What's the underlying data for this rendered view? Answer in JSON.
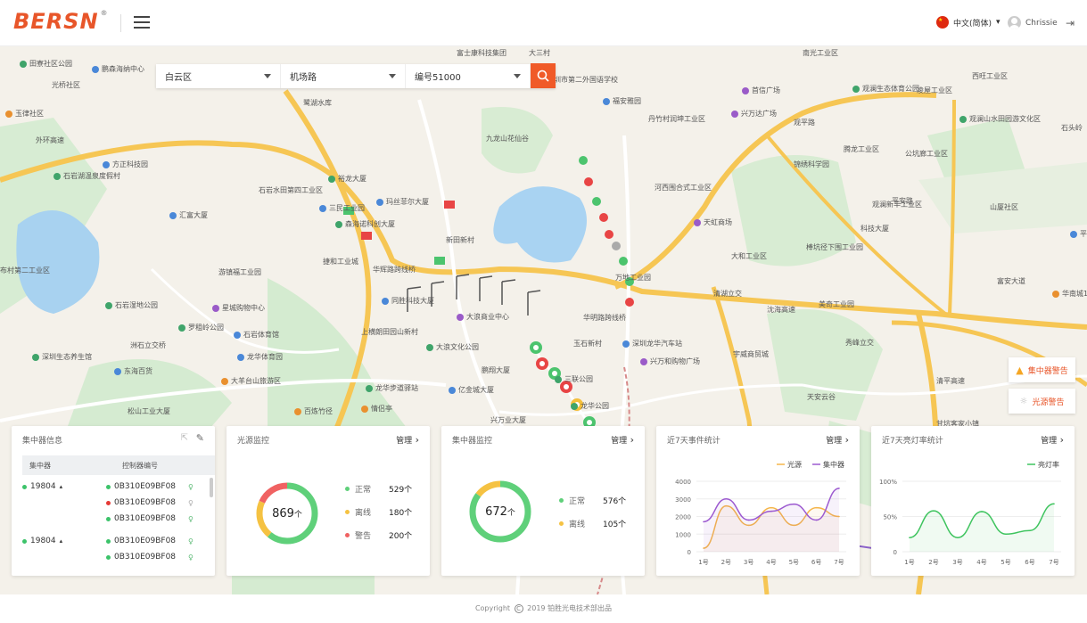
{
  "header": {
    "logo": "BERSN",
    "logo_mark": "®",
    "language": "中文(简体)",
    "user_name": "Chrissie"
  },
  "search": {
    "district": "白云区",
    "road": "机场路",
    "number": "编号51000"
  },
  "map_labels": [
    "田寮社区公园",
    "鹏森海纳中心",
    "光桥社区",
    "玉律社区",
    "外环高速",
    "方正科技园",
    "石岩湖温泉度假村",
    "汇富大厦",
    "石岩水田第四工业区",
    "三民工业园",
    "森海诺科创大厦",
    "玛丝菲尔大厦",
    "裕龙大厦",
    "新田新村",
    "游镇福工业园",
    "捷和工业城",
    "华辉路跨线桥",
    "同胜科技大厦",
    "星城购物中心",
    "布村第二工业区",
    "石岩湿地公园",
    "罗租岭公园",
    "石岩体育馆",
    "洲石立交桥",
    "深圳生态养生馆",
    "东海百货",
    "龙华体育园",
    "大羊台山旅游区",
    "松山工业大厦",
    "上横朗田园山新村",
    "大浪商业中心",
    "大浪文化公园",
    "华明路跨线桥",
    "玉石新村",
    "深圳龙华汽车站",
    "鹏翔大厦",
    "三联公园",
    "龙华公园",
    "亿金城大厦",
    "龙华步道驿站",
    "百炼竹径",
    "情侣亭",
    "兴万业大厦",
    "富士康科技集团",
    "大三村",
    "深圳市第二外国语学校",
    "福安雅园",
    "丹竹村润坤工业区",
    "兴万达广场",
    "首信广场",
    "南光工业区",
    "九龙山花仙谷",
    "河西围合式工业区",
    "天虹商场",
    "大和工业区",
    "棒坑径下围工业园",
    "锦绣科学园",
    "腾龙工业区",
    "公坑廊工业区",
    "观澜新丰工业区",
    "科技大厦",
    "观澜生态体育公园",
    "凌屋工业区",
    "西旺工业区",
    "观澜山水田园游文化区",
    "平湖站",
    "山厦社区",
    "富安大道",
    "万地工业园",
    "清湖立交",
    "沈海高速",
    "秀峰立交",
    "宇威商贸城",
    "兴万和购物广场",
    "天安云谷",
    "华南城1号交易广场",
    "甘坑客家小镇",
    "美奇工业园",
    "鹭湖水库",
    "观平路",
    "平安路",
    "清平高速",
    "石头岭"
  ],
  "alerts": {
    "concentrator": "集中器警告",
    "light": "光源警告"
  },
  "panel_concentrator": {
    "title": "集中器信息",
    "col1": "集中器",
    "col2": "控制器编号",
    "groups": [
      {
        "id": "19804",
        "items": [
          {
            "code": "0B310E09BF08",
            "status": "normal"
          },
          {
            "code": "0B310E09BF08",
            "status": "alarm"
          },
          {
            "code": "0B310E09BF08",
            "status": "normal"
          }
        ]
      },
      {
        "id": "19804",
        "items": [
          {
            "code": "0B310E09BF08",
            "status": "normal"
          },
          {
            "code": "0B310E09BF08",
            "status": "normal"
          }
        ]
      }
    ]
  },
  "panel_light": {
    "title": "光源监控",
    "manage": "管理",
    "total": "869",
    "unit": "个",
    "legend": [
      {
        "name": "正常",
        "value": "529个",
        "color": "#5fd07a"
      },
      {
        "name": "离线",
        "value": "180个",
        "color": "#f5c242"
      },
      {
        "name": "警告",
        "value": "200个",
        "color": "#f06262"
      }
    ]
  },
  "panel_conc_monitor": {
    "title": "集中器监控",
    "manage": "管理",
    "total": "672",
    "unit": "个",
    "legend": [
      {
        "name": "正常",
        "value": "576个",
        "color": "#5fd07a"
      },
      {
        "name": "离线",
        "value": "105个",
        "color": "#f5c242"
      }
    ]
  },
  "panel_events": {
    "title": "近7天事件统计",
    "manage": "管理",
    "series_names": [
      "光源",
      "集中器"
    ]
  },
  "panel_rate": {
    "title": "近7天亮灯率统计",
    "manage": "管理",
    "series_name": "亮灯率"
  },
  "chart_data": [
    {
      "type": "line",
      "title": "近7天事件统计",
      "x": [
        "1号",
        "2号",
        "3号",
        "4号",
        "5号",
        "6号",
        "7号"
      ],
      "ylim": [
        0,
        4000
      ],
      "yticks": [
        0,
        1000,
        2000,
        3000,
        4000
      ],
      "series": [
        {
          "name": "光源",
          "color": "#f5b54a",
          "values": [
            200,
            2600,
            1500,
            2500,
            1500,
            2500,
            2000
          ]
        },
        {
          "name": "集中器",
          "color": "#9c5ad0",
          "values": [
            1700,
            3000,
            1800,
            2300,
            2700,
            1800,
            3600
          ]
        }
      ],
      "legend": "top-right"
    },
    {
      "type": "line",
      "title": "近7天亮灯率统计",
      "x": [
        "1号",
        "2号",
        "3号",
        "4号",
        "5号",
        "6号",
        "7号"
      ],
      "ylim": [
        0,
        100
      ],
      "yticks": [
        "0",
        "50%",
        "100%"
      ],
      "series": [
        {
          "name": "亮灯率",
          "color": "#3fc45f",
          "values": [
            20,
            58,
            20,
            57,
            25,
            30,
            68
          ]
        }
      ],
      "legend": "top-right"
    }
  ],
  "footer": {
    "prefix": "Copyright",
    "mark": "C",
    "text": "2019 铂胜光电技术部出品"
  }
}
